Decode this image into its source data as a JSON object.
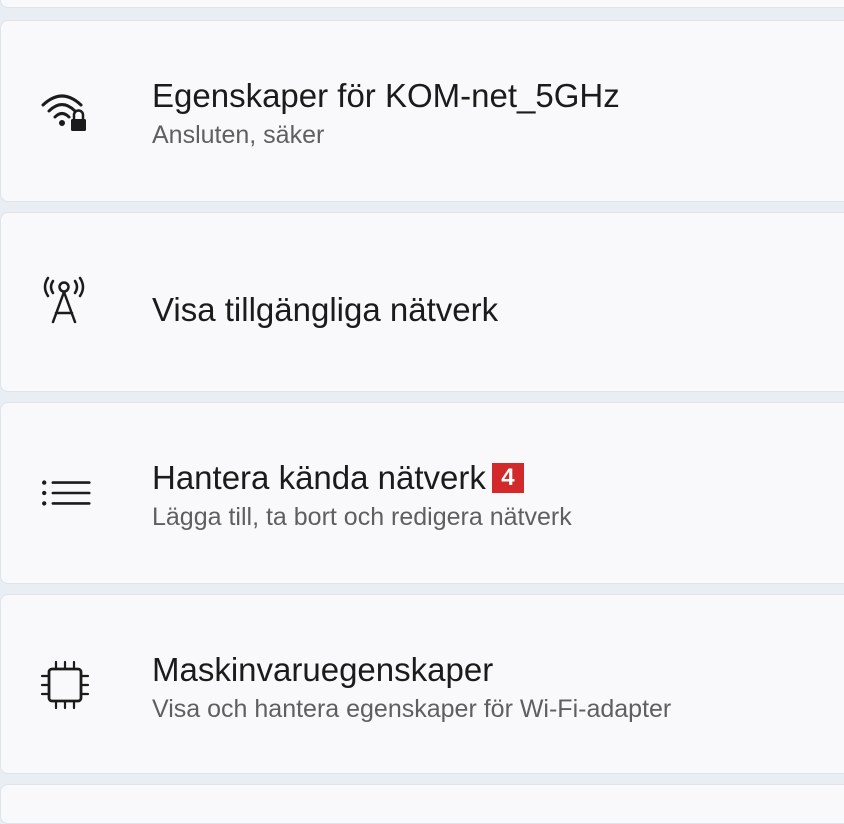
{
  "wifi_properties": {
    "title": "Egenskaper för KOM-net_5GHz",
    "subtitle": "Ansluten, säker",
    "icon": "wifi-lock-icon"
  },
  "available_networks": {
    "title": "Visa tillgängliga nätverk",
    "icon": "antenna-icon"
  },
  "known_networks": {
    "title": "Hantera kända nätverk",
    "badge": "4",
    "subtitle": "Lägga till, ta bort och redigera nätverk",
    "icon": "list-icon",
    "badge_color": "#d22a2a"
  },
  "hardware_properties": {
    "title": "Maskinvaruegenskaper",
    "subtitle": "Visa och hantera egenskaper för Wi-Fi-adapter",
    "icon": "chip-icon"
  }
}
